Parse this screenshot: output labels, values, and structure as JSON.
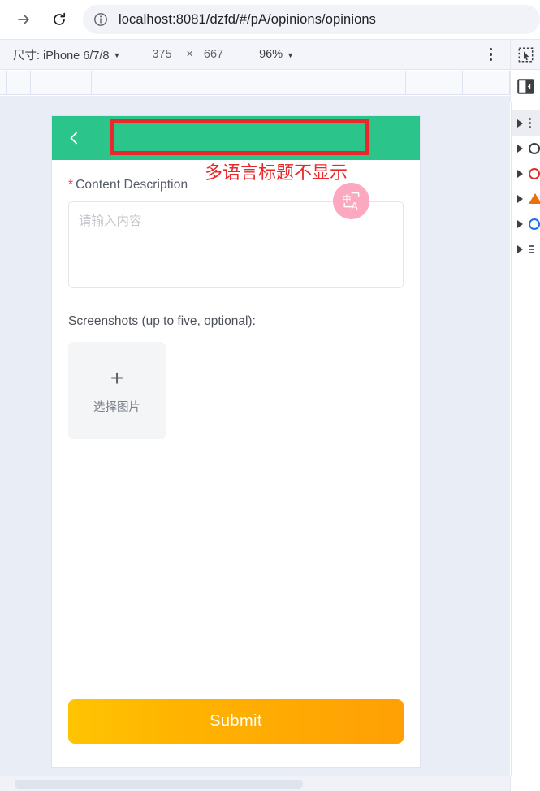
{
  "browser": {
    "url": "localhost:8081/dzfd/#/pA/opinions/opinions",
    "forward_icon": "forward-arrow-icon",
    "reload_icon": "reload-icon",
    "site_info_icon": "info-circle-icon"
  },
  "device_toolbar": {
    "size_label": "尺寸: iPhone 6/7/8",
    "size_caret": "▼",
    "width": "375",
    "times": "×",
    "height": "667",
    "zoom": "96%",
    "zoom_caret": "▼",
    "more_icon": "kebab-menu-icon",
    "inspect_icon": "inspect-element-icon",
    "dock_icon": "dock-panel-left-icon"
  },
  "tab_strip": {
    "cells": [
      9,
      29,
      40,
      35,
      1007,
      35,
      35,
      35,
      58
    ]
  },
  "console_panel": {
    "rows": [
      {
        "icon": "kebab-menu-icon",
        "selected": true
      },
      {
        "icon": "circle-dark-icon",
        "selected": false
      },
      {
        "icon": "error-circle-icon",
        "selected": false
      },
      {
        "icon": "warning-triangle-icon",
        "selected": false
      },
      {
        "icon": "info-circle-icon",
        "selected": false
      },
      {
        "icon": "list-bars-icon",
        "selected": false
      }
    ]
  },
  "app": {
    "header": {
      "back_icon": "back-chevron-icon",
      "title": ""
    },
    "form": {
      "content_required_star": "*",
      "content_label": "Content Description",
      "content_value": "",
      "content_placeholder": "请输入内容",
      "screenshots_label": "Screenshots (up to five, optional):",
      "uploader_plus": "+",
      "uploader_text": "选择图片"
    },
    "translate_fab": {
      "icon": "translate-icon",
      "cn_glyph": "中",
      "en_glyph": "A"
    },
    "submit_label": "Submit"
  },
  "annotations": {
    "rect_name": "missing-title-highlight",
    "note": "多语言标题不显示"
  },
  "colors": {
    "app_header_green": "#2bc48a",
    "annotation_red": "#e8282a",
    "submit_orange_start": "#ffc402",
    "submit_orange_end": "#ff9f05",
    "fab_pink": "#fba8c0",
    "devtools_bg": "#f3f5fa",
    "viewport_backdrop": "#e9edf6"
  }
}
